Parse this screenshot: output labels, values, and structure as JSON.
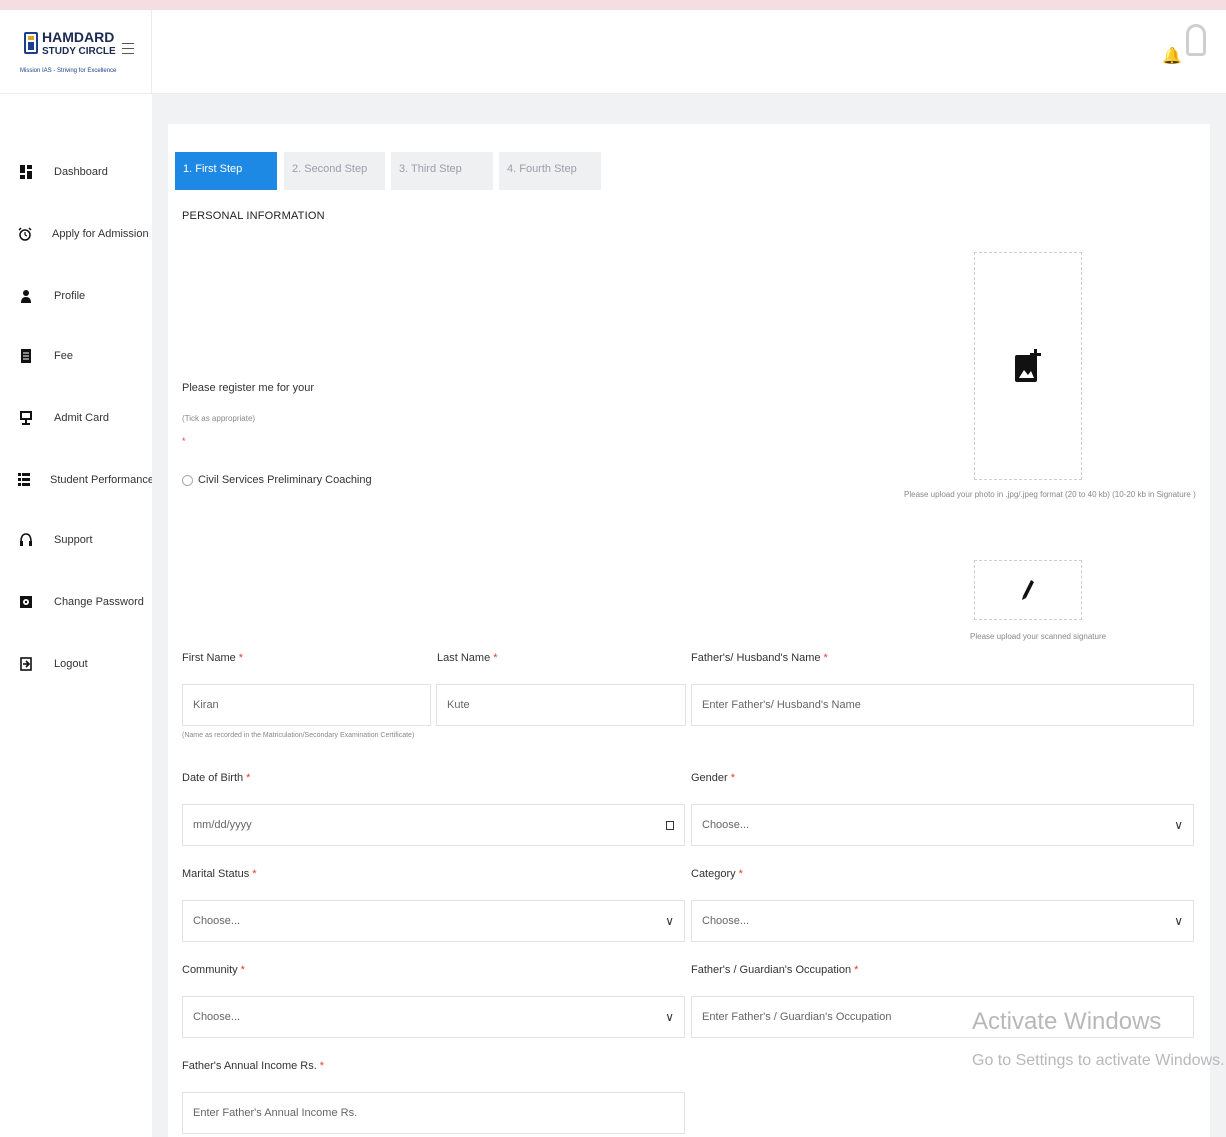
{
  "brand": {
    "name_line1": "HAMDARD",
    "name_line2": "STUDY CIRCLE",
    "tagline": "Mission IAS - Striving for Excellence"
  },
  "header": {
    "bell_icon": "bell-icon",
    "avatar_icon": "user-avatar"
  },
  "sidebar": {
    "items": [
      {
        "label": "Dashboard",
        "icon": "dashboard-icon"
      },
      {
        "label": "Apply for Admission",
        "icon": "alarm-clock-icon"
      },
      {
        "label": "Profile",
        "icon": "person-icon"
      },
      {
        "label": "Fee",
        "icon": "receipt-icon"
      },
      {
        "label": "Admit Card",
        "icon": "display-icon"
      },
      {
        "label": "Student Performance",
        "icon": "list-icon"
      },
      {
        "label": "Support",
        "icon": "headset-icon"
      },
      {
        "label": "Change Password",
        "icon": "settings-icon"
      },
      {
        "label": "Logout",
        "icon": "logout-icon"
      }
    ]
  },
  "tabs": [
    {
      "label": "1. First Step",
      "active": true
    },
    {
      "label": "2. Second Step",
      "active": false
    },
    {
      "label": "3. Third Step",
      "active": false
    },
    {
      "label": "4. Fourth Step",
      "active": false
    }
  ],
  "form": {
    "section_title": "PERSONAL INFORMATION",
    "register_label": "Please register me for your",
    "register_hint": "(Tick as appropriate)",
    "required_mark": "*",
    "course_option": "Civil Services Preliminary Coaching",
    "photo_hint": "Please upload your photo in .jpg/.jpeg format (20 to 40 kb) (10-20 kb in Signature )",
    "signature_hint": "Please upload your scanned signature",
    "first_name": {
      "label": "First Name",
      "value": "Kiran"
    },
    "last_name": {
      "label": "Last Name",
      "value": "Kute"
    },
    "father_name": {
      "label": "Father's/ Husband's Name",
      "placeholder": "Enter Father's/ Husband's Name"
    },
    "name_note": "(Name as recorded in the Matriculation/Secondary Examination Certificate)",
    "dob": {
      "label": "Date of Birth",
      "placeholder": "mm/dd/yyyy"
    },
    "gender": {
      "label": "Gender",
      "value": "Choose..."
    },
    "marital_status": {
      "label": "Marital Status",
      "value": "Choose..."
    },
    "category": {
      "label": "Category",
      "value": "Choose..."
    },
    "community": {
      "label": "Community",
      "value": "Choose..."
    },
    "occupation": {
      "label": "Father's / Guardian's Occupation",
      "placeholder": "Enter Father's / Guardian's Occupation"
    },
    "income": {
      "label": "Father's Annual Income Rs.",
      "placeholder": "Enter Father's Annual Income Rs."
    }
  },
  "watermark": {
    "title": "Activate Windows",
    "subtitle": "Go to Settings to activate Windows."
  },
  "colors": {
    "accent": "#1e88e5",
    "required": "#e53935",
    "background": "#f1f2f4"
  }
}
